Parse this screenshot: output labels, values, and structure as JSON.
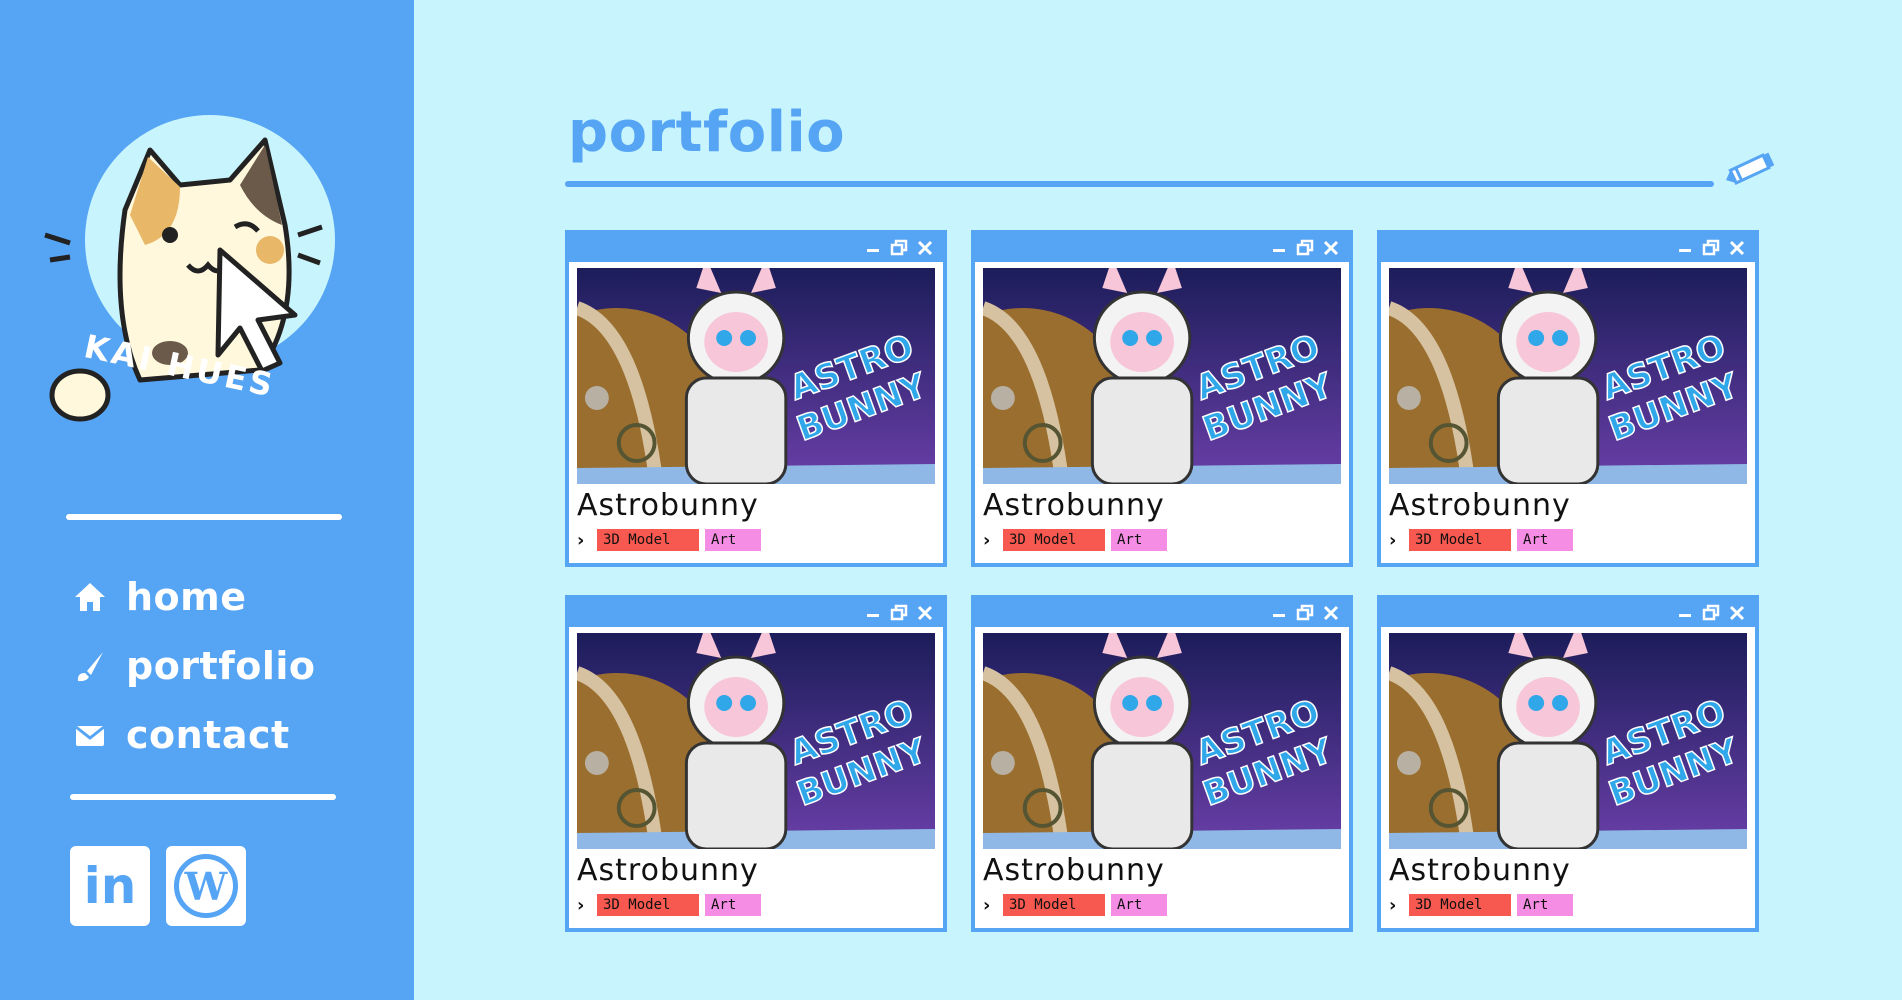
{
  "brand": {
    "name": "KAI HUES"
  },
  "nav": {
    "items": [
      {
        "label": "home",
        "icon": "home-icon"
      },
      {
        "label": "portfolio",
        "icon": "brush-icon"
      },
      {
        "label": "contact",
        "icon": "mail-icon"
      }
    ]
  },
  "social": [
    {
      "label": "in",
      "icon": "linkedin-icon"
    },
    {
      "label": "W",
      "icon": "wordpress-icon"
    }
  ],
  "main": {
    "title": "portfolio"
  },
  "cards": [
    {
      "title": "Astrobunny",
      "tags": [
        "3D Model",
        "Art"
      ]
    },
    {
      "title": "Astrobunny",
      "tags": [
        "3D Model",
        "Art"
      ]
    },
    {
      "title": "Astrobunny",
      "tags": [
        "3D Model",
        "Art"
      ]
    },
    {
      "title": "Astrobunny",
      "tags": [
        "3D Model",
        "Art"
      ]
    },
    {
      "title": "Astrobunny",
      "tags": [
        "3D Model",
        "Art"
      ]
    },
    {
      "title": "Astrobunny",
      "tags": [
        "3D Model",
        "Art"
      ]
    }
  ],
  "card_image_logo": {
    "line1": "ASTRO",
    "line2": "BUNNY"
  },
  "colors": {
    "sidebar": "#56a4f4",
    "background": "#c8f4fe",
    "tag_model": "#f7584f",
    "tag_art": "#f68de5"
  }
}
